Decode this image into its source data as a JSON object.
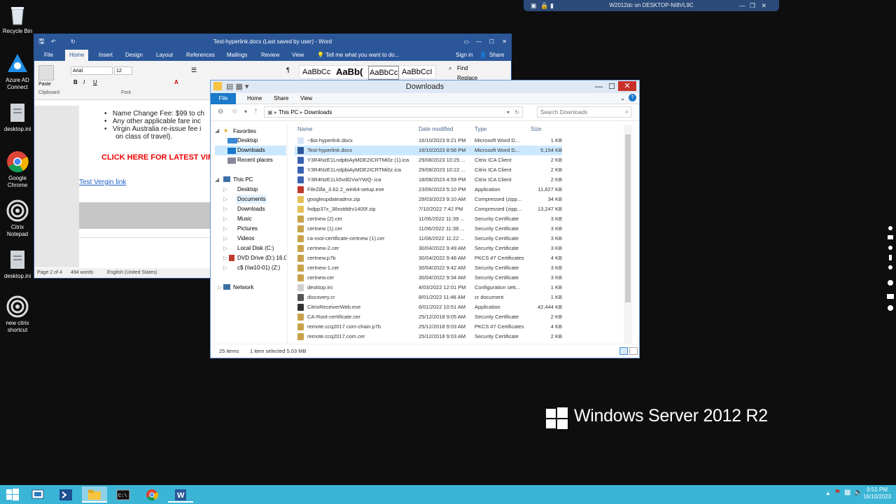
{
  "desktop": {
    "icons": [
      {
        "label": "Recycle Bin",
        "icon": "recycle-bin-icon"
      },
      {
        "label": "Azure AD Connect",
        "icon": "azure-ad-icon"
      },
      {
        "label": "desktop.ini",
        "icon": "ini-file-icon"
      },
      {
        "label": "Google Chrome",
        "icon": "chrome-icon"
      },
      {
        "label": "Citrix Notepad",
        "icon": "citrix-icon"
      },
      {
        "label": "desktop.ini",
        "icon": "ini-file-icon"
      },
      {
        "label": "new citrix shortcut",
        "icon": "citrix-icon"
      }
    ],
    "brand": "Windows Server 2012 R2"
  },
  "remote_bar": {
    "title": "W2012dc on DESKTOP-NI8VL9C"
  },
  "word": {
    "title": "Test-hyperlink.docx (Last saved by user) - Word",
    "tabs": [
      "File",
      "Home",
      "Insert",
      "Design",
      "Layout",
      "References",
      "Mailings",
      "Review",
      "View"
    ],
    "tell_me": "Tell me what you want to do...",
    "sign_in": "Sign in",
    "share": "Share",
    "font_name": "Arial",
    "font_size": "12",
    "paste": "Paste",
    "clipboard": "Clipboard",
    "font_group": "Font",
    "styles": [
      "AaBbCc",
      "AaBb(",
      "AaBbCc",
      "AaBbCcI"
    ],
    "find": "Find",
    "replace": "Replace",
    "doc_lines": [
      "Name Change Fee: $99 to ch",
      "Any other applicable fare inc",
      "Virgin Australia re-issue fee i",
      "on class of travel)."
    ],
    "doc_heading": "CLICK HERE FOR LATEST VIRG",
    "doc_link": "Test Vergin link",
    "status_page": "Page 2 of 4",
    "status_words": "494 words",
    "status_lang": "English (United States)"
  },
  "explorer": {
    "title": "Downloads",
    "ribbon_tabs": [
      "File",
      "Home",
      "Share",
      "View"
    ],
    "breadcrumb": [
      "This PC",
      "Downloads"
    ],
    "search_placeholder": "Search Downloads",
    "nav": {
      "favorites": "Favorites",
      "fav_items": [
        "Desktop",
        "Downloads",
        "Recent places"
      ],
      "this_pc": "This PC",
      "pc_items": [
        "Desktop",
        "Documents",
        "Downloads",
        "Music",
        "Pictures",
        "Videos",
        "Local Disk (C:)",
        "DVD Drive (D:) 16.0.4",
        "c$ (\\\\w10-01) (Z:)"
      ],
      "network": "Network"
    },
    "columns": [
      "Name",
      "Date modified",
      "Type",
      "Size"
    ],
    "files": [
      {
        "name": "~$st-hyperlink.docx",
        "date": "16/10/2023 9:21 PM",
        "type": "Microsoft Word D...",
        "size": "1 KB",
        "color": "#d8e4f5"
      },
      {
        "name": "Test-hyperlink.docx",
        "date": "16/10/2023 8:56 PM",
        "type": "Microsoft Word D...",
        "size": "5,154 KB",
        "color": "#2b579a"
      },
      {
        "name": "Y3R4NzE1LndpbiAyMDE2ICRTMi0z (1).ica",
        "date": "29/08/2023 10:25 ...",
        "type": "Citrix ICA Client",
        "size": "2 KB",
        "color": "#3b62b0"
      },
      {
        "name": "Y3R4NzE1LndpbiAyMDE2ICRTMi0z.ica",
        "date": "29/08/2023 10:22 ...",
        "type": "Citrix ICA Client",
        "size": "2 KB",
        "color": "#3b62b0"
      },
      {
        "name": "Y3R4NzE1Lk5vdGVwYWQ-.ica",
        "date": "18/08/2023 4:59 PM",
        "type": "Citrix ICA Client",
        "size": "2 KB",
        "color": "#3b62b0"
      },
      {
        "name": "FileZilla_3.62.2_win64-setup.exe",
        "date": "23/06/2023 5:10 PM",
        "type": "Application",
        "size": "11,627 KB",
        "color": "#c0392b"
      },
      {
        "name": "googleupdateadmx.zip",
        "date": "29/03/2023 9:10 AM",
        "type": "Compressed (zipp...",
        "size": "34 KB",
        "color": "#e4c25a"
      },
      {
        "name": "fxdpp37x_38xstddrv1400f.zip",
        "date": "7/10/2022 7:42 PM",
        "type": "Compressed (zipp...",
        "size": "13,247 KB",
        "color": "#e4c25a"
      },
      {
        "name": "certnew (2).cer",
        "date": "11/06/2022 11:39 ...",
        "type": "Security Certificate",
        "size": "3 KB",
        "color": "#c8a24a"
      },
      {
        "name": "certnew (1).cer",
        "date": "11/06/2022 11:38 ...",
        "type": "Security Certificate",
        "size": "3 KB",
        "color": "#c8a24a"
      },
      {
        "name": "ca-root-certificate-certnew (1).cer",
        "date": "11/06/2022 11:22 ...",
        "type": "Security Certificate",
        "size": "3 KB",
        "color": "#c8a24a"
      },
      {
        "name": "certnew-2.cer",
        "date": "30/04/2022 9:49 AM",
        "type": "Security Certificate",
        "size": "3 KB",
        "color": "#c8a24a"
      },
      {
        "name": "certnew.p7b",
        "date": "30/04/2022 9:48 AM",
        "type": "PKCS #7 Certificates",
        "size": "4 KB",
        "color": "#c8a24a"
      },
      {
        "name": "certnew-1.cer",
        "date": "30/04/2022 9:42 AM",
        "type": "Security Certificate",
        "size": "3 KB",
        "color": "#c8a24a"
      },
      {
        "name": "certnew.cer",
        "date": "30/04/2022 9:34 AM",
        "type": "Security Certificate",
        "size": "3 KB",
        "color": "#c8a24a"
      },
      {
        "name": "desktop.ini",
        "date": "4/03/2022 12:01 PM",
        "type": "Configuration sett...",
        "size": "1 KB",
        "color": "#d0d0d0"
      },
      {
        "name": "discovery.cr",
        "date": "8/01/2022 11:48 AM",
        "type": "cr document",
        "size": "1 KB",
        "color": "#555555"
      },
      {
        "name": "CitrixReceiverWeb.exe",
        "date": "6/01/2022 10:51 AM",
        "type": "Application",
        "size": "42,444 KB",
        "color": "#333333"
      },
      {
        "name": "CA-Root-certificate.cer",
        "date": "25/12/2018 9:05 AM",
        "type": "Security Certificate",
        "size": "2 KB",
        "color": "#c8a24a"
      },
      {
        "name": "remote.ccq2017.com-chain.p7b",
        "date": "25/12/2018 9:03 AM",
        "type": "PKCS #7 Certificates",
        "size": "4 KB",
        "color": "#c8a24a"
      },
      {
        "name": "remote.ccq2017.com.cer",
        "date": "25/12/2018 9:03 AM",
        "type": "Security Certificate",
        "size": "2 KB",
        "color": "#c8a24a"
      }
    ],
    "status_count": "25 items",
    "status_selected": "1 item selected  5.03 MB"
  },
  "taskbar": {
    "apps": [
      "start-icon",
      "server-manager-icon",
      "powershell-icon",
      "file-explorer-icon",
      "cmd-icon",
      "chrome-icon",
      "word-icon"
    ],
    "time": "9:51 PM",
    "date": "16/10/2023"
  }
}
